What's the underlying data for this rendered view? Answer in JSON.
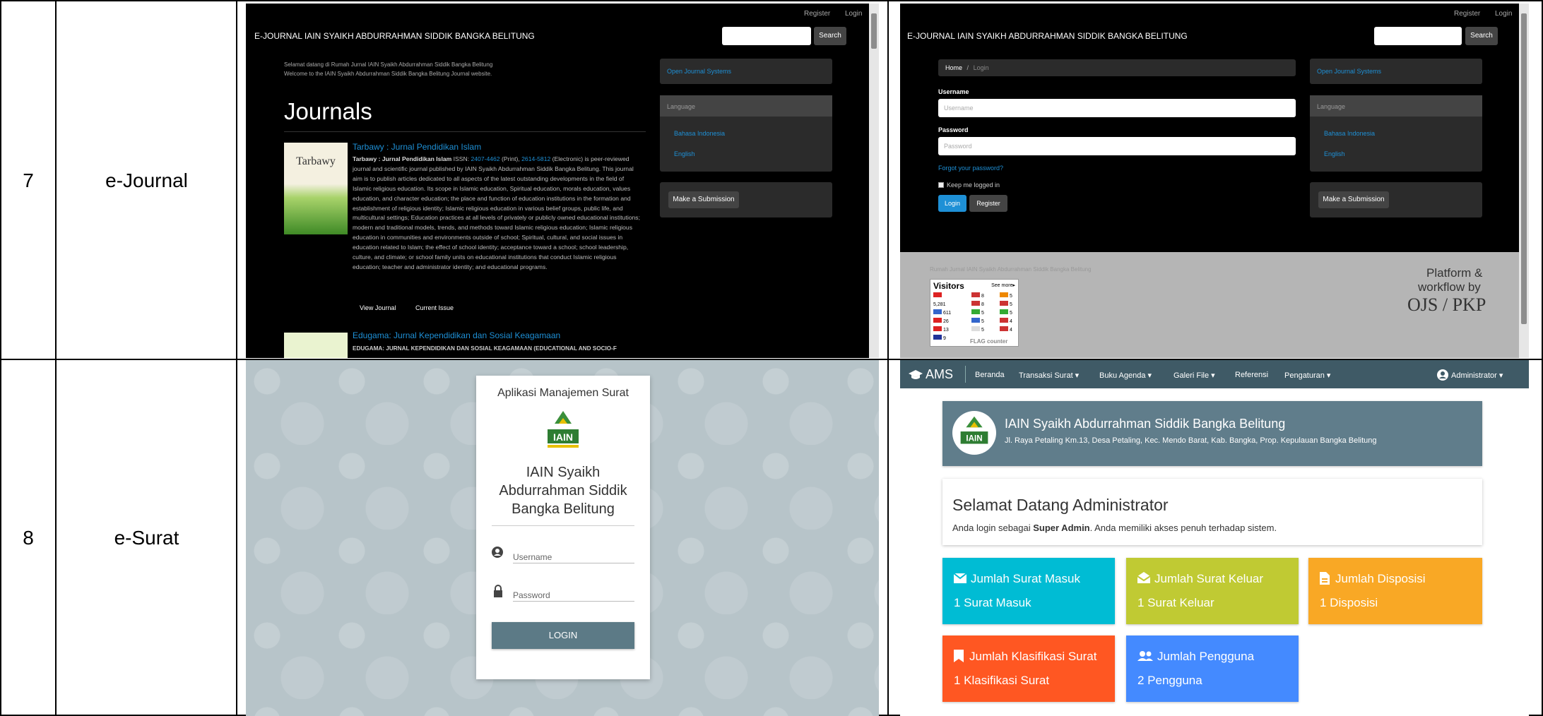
{
  "table": {
    "rows": [
      {
        "number": "7",
        "name": "e-Journal"
      },
      {
        "number": "8",
        "name": "e-Surat"
      }
    ]
  },
  "ejournal_home": {
    "top_links": [
      "Register",
      "Login"
    ],
    "site_title": "E-JOURNAL IAIN SYAIKH ABDURRAHMAN SIDDIK BANGKA BELITUNG",
    "search_button": "Search",
    "welcome_line1": "Selamat datang di Rumah Jurnal IAIN Syaikh Abdurrahman Siddik Bangka Belitung",
    "welcome_line2": "Welcome to the IAIN Syaikh Abdurrahman Siddik Bangka Belitung Journal website.",
    "heading": "Journals",
    "journal1": {
      "cover_text": "Tarbawy",
      "title": "Tarbawy : Jurnal Pendidikan Islam",
      "desc_bold": "Tarbawy : Jurnal Pendidikan Islam",
      "issn_prefix": " ISSN: ",
      "issn_print": "2407-4462",
      "issn_mid": " (Print), ",
      "issn_elec": "2614-5812",
      "issn_suffix": " (Electronic) is peer-reviewed journal and scientific journal published by IAIN Syaikh Abdurrahman Siddik Bangka Belitung. This journal aim is to publish articles dedicated to all aspects of the latest outstanding developments in the field of Islamic religious education. Its scope in Islamic education, Spiritual education, morals education, values education, and character education; the place and function of education institutions in the formation and establishment of religious identity; Islamic religious education in various belief groups, public life, and multicultural settings; Education practices at all levels of privately or publicly owned educational institutions; modern and traditional models, trends, and methods toward Islamic religious education; Islamic religious education in communities and environments outside of school; Spiritual, cultural, and social issues in education related to Islam; the effect of school identity; acceptance toward a school; school leadership, culture, and climate; or school family units on educational institutions that conduct Islamic religious education; teacher and administrator identity; and educational programs.",
      "view_journal": "View Journal",
      "current_issue": "Current Issue"
    },
    "journal2": {
      "title": "Edugama: Jurnal Kependidikan dan Sosial Keagamaan",
      "subtitle": "EDUGAMA: JURNAL KEPENDIDIKAN DAN SOSIAL KEAGAMAAN (EDUCATIONAL AND SOCIO-F"
    },
    "sidebar": {
      "ojs_link": "Open Journal Systems",
      "language_header": "Language",
      "languages": [
        "Bahasa Indonesia",
        "English"
      ],
      "submission_button": "Make a Submission"
    }
  },
  "ejournal_login": {
    "top_links": [
      "Register",
      "Login"
    ],
    "site_title": "E-JOURNAL IAIN SYAIKH ABDURRAHMAN SIDDIK BANGKA BELITUNG",
    "search_button": "Search",
    "breadcrumb_home": "Home",
    "breadcrumb_sep": "/",
    "breadcrumb_current": "Login",
    "username_label": "Username",
    "username_placeholder": "Username",
    "password_label": "Password",
    "password_placeholder": "Password",
    "forgot_link": "Forgot your password?",
    "keep_logged": "Keep me logged in",
    "login_button": "Login",
    "register_button": "Register",
    "sidebar": {
      "ojs_link": "Open Journal Systems",
      "language_header": "Language",
      "languages": [
        "Bahasa Indonesia",
        "English"
      ],
      "submission_button": "Make a Submission"
    },
    "footer": {
      "footer_text": "Rumah Jurnal IAIN Syaikh Abdurrahman Siddik Bangka Belitung",
      "visitors_title": "Visitors",
      "see_more": "See more▸",
      "counts_col1": [
        "5,281",
        "611",
        "26",
        "13",
        "9"
      ],
      "counts_col2": [
        "8",
        "8",
        "5",
        "5",
        "5"
      ],
      "counts_col3": [
        "5",
        "5",
        "5",
        "4",
        "4"
      ],
      "flag_counter": "FLAG counter",
      "platform_line1": "Platform &",
      "platform_line2": "workflow by",
      "ojs_logo": "OJS / PKP"
    }
  },
  "esurat_login": {
    "app_title": "Aplikasi Manajemen Surat",
    "logo_text": "IAIN",
    "institution_line1": "IAIN Syaikh",
    "institution_line2": "Abdurrahman Siddik",
    "institution_line3": "Bangka Belitung",
    "username_placeholder": "Username",
    "password_placeholder": "Password",
    "login_button": "LOGIN"
  },
  "esurat_dashboard": {
    "brand": "AMS",
    "nav": [
      "Beranda",
      "Transaksi Surat ▾",
      "Buku Agenda ▾",
      "Galeri File ▾",
      "Referensi",
      "Pengaturan ▾"
    ],
    "user_menu": "Administrator ▾",
    "institution_name": "IAIN Syaikh Abdurrahman Siddik Bangka Belitung",
    "institution_address": "Jl. Raya Petaling Km.13, Desa Petaling, Kec. Mendo Barat, Kab. Bangka, Prop. Kepulauan Bangka Belitung",
    "welcome_title": "Selamat Datang Administrator",
    "welcome_prefix": "Anda login sebagai ",
    "welcome_role": "Super Admin",
    "welcome_suffix": ". Anda memiliki akses penuh terhadap sistem.",
    "tiles": [
      {
        "title": "Jumlah Surat Masuk",
        "value": "1 Surat Masuk",
        "color": "#00bcd4",
        "icon": "mail-icon"
      },
      {
        "title": "Jumlah Surat Keluar",
        "value": "1 Surat Keluar",
        "color": "#c0ca33",
        "icon": "mail-open-icon"
      },
      {
        "title": "Jumlah Disposisi",
        "value": "1 Disposisi",
        "color": "#f9a825",
        "icon": "document-icon"
      },
      {
        "title": "Jumlah Klasifikasi Surat",
        "value": "1 Klasifikasi Surat",
        "color": "#ff5722",
        "icon": "bookmark-icon"
      },
      {
        "title": "Jumlah Pengguna",
        "value": "2 Pengguna",
        "color": "#448aff",
        "icon": "users-icon"
      }
    ]
  }
}
